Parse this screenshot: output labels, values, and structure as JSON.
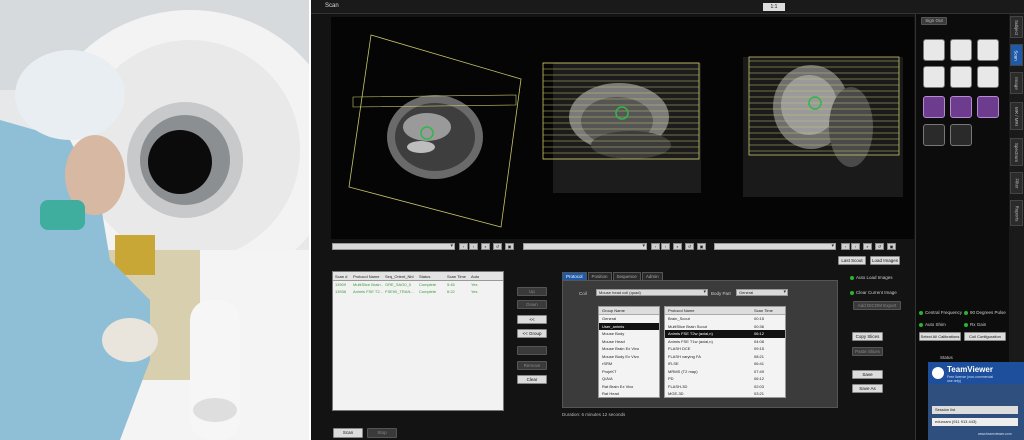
{
  "window": {
    "title": "Scan",
    "zoom": "1:1"
  },
  "scan_actions": {
    "last_scout": "Last Scout",
    "load_images": "Load Images"
  },
  "queue": {
    "headers": [
      "Scan #",
      "Protocol Name",
      "Seq_Orient_Nbl",
      "Status",
      "Scan Time",
      "Auto"
    ],
    "rows": [
      [
        "13909",
        "MultiSlice Brain...",
        "GRE_SAG0_0",
        "Complete",
        "5:45",
        "Yes"
      ],
      [
        "13936",
        "Animis FSE T2...",
        "FSE90_TRAN...",
        "Complete",
        "6:22",
        "Yes"
      ]
    ]
  },
  "queue_buttons": {
    "up": "Up",
    "down": "Down",
    "move": "<<",
    "group": "<< Group",
    "remove": "Remove",
    "clear": "Clear",
    "scan": "Scan",
    "stop": "Stop"
  },
  "protocol": {
    "tabs": [
      "Protocol",
      "Position",
      "Sequence",
      "Admin"
    ],
    "coil_label": "Coil",
    "coil_value": "Mouse head coil (quad)",
    "body_part_label": "Body Part",
    "body_part_value": "General",
    "group_header": "Group Name",
    "groups": [
      "General",
      "User_animis",
      "Mouse Body",
      "Mouse Head",
      "Mouse Brain Ex Vivo",
      "Mouse Body Ex Vivo",
      "rSRM",
      "ProjeKT",
      "Q/A/A",
      "Rat Brain Ex Vivo",
      "Rat Head",
      "Rat Body"
    ],
    "group_selected": 1,
    "prot_headers": [
      "Protocol Name",
      "Scan Time"
    ],
    "protocols": [
      [
        "Brain_Scout",
        "00:15"
      ],
      [
        "MultiSlice Brain Scout",
        "00:36"
      ],
      [
        "Animis FSE T2w (axial,n)",
        "06:12"
      ],
      [
        "Animis FSE T1w (axial,n)",
        "04:08"
      ],
      [
        "FLASH DCE",
        "09:15"
      ],
      [
        "FLASH varying FA",
        "08:21"
      ],
      [
        "IR-SE",
        "06:41"
      ],
      [
        "MRMS (T2 map)",
        "07:49"
      ],
      [
        "PD",
        "06:12"
      ],
      [
        "FLASH-3D",
        "02:03"
      ],
      [
        "MGE-3D",
        "03:21"
      ],
      [
        "FSE T2w-3D",
        "28:52"
      ],
      [
        "FSE T2w-3D (x)",
        "28:52"
      ]
    ],
    "prot_selected": 2,
    "duration": "Duration: 6 minutes 12 seconds"
  },
  "right_buttons": {
    "copy": "Copy Slices",
    "paste": "Paste Slices",
    "save": "Save",
    "save_as": "Save As"
  },
  "auto": {
    "load": "Auto Load Images",
    "clear": "Clear Current Image",
    "add": "Add DICOM Export"
  },
  "calib": {
    "cf": "Central Frequency",
    "ninety": "90 Degrees Pulse",
    "shim": "Auto Shim",
    "rx": "Rx Gain",
    "select_all": "Select All Calibrations",
    "coil_config": "Coil Configuration"
  },
  "sidebar": {
    "sign_out": "Sign Out",
    "status": "Status",
    "tabs": [
      "Subject",
      "Scan",
      "Image",
      "MR / MRI",
      "Spectrum",
      "Filter",
      "Reports"
    ],
    "active_tab": 1
  },
  "teamviewer": {
    "name": "TeamViewer",
    "line1": "Free license (non-commercial",
    "line2": "use only)",
    "session": "Session list",
    "device": "eduroam (911 913 443)",
    "website": "www.teamviewer.com"
  },
  "colors": {
    "accent": "#1e5aa8",
    "ok": "#2bb52b",
    "scout": "#c9c66a",
    "marker": "#2fb84a"
  }
}
